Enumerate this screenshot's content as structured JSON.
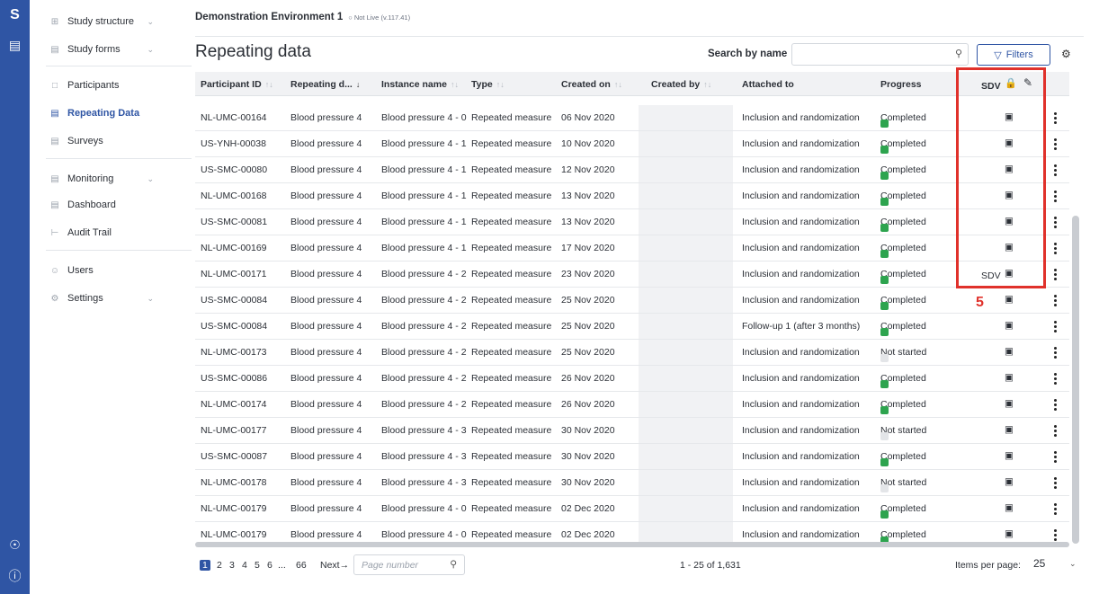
{
  "rail": {
    "logo": "S",
    "book_icon": "book-icon",
    "bottom_icons": [
      "user-circle-icon",
      "help-circle-icon"
    ]
  },
  "sidebar": {
    "items": [
      {
        "label": "Study structure",
        "icon": "structure-icon",
        "chevron": true
      },
      {
        "label": "Study forms",
        "icon": "forms-icon",
        "chevron": true
      },
      {
        "label": "Participants",
        "icon": "folder-icon"
      },
      {
        "label": "Repeating Data",
        "icon": "repeating-data-icon",
        "active": true
      },
      {
        "label": "Surveys",
        "icon": "surveys-icon"
      },
      {
        "label": "Monitoring",
        "icon": "monitoring-icon",
        "chevron": true
      },
      {
        "label": "Dashboard",
        "icon": "dashboard-icon"
      },
      {
        "label": "Audit Trail",
        "icon": "audit-trail-icon"
      },
      {
        "label": "Users",
        "icon": "users-icon"
      },
      {
        "label": "Settings",
        "icon": "settings-icon",
        "chevron": true
      }
    ]
  },
  "header": {
    "env_name": "Demonstration Environment 1",
    "env_status": "Not Live (v.117.41)"
  },
  "page": {
    "title": "Repeating data",
    "search_label": "Search by name",
    "search_placeholder": "",
    "filters_label": "Filters"
  },
  "table": {
    "columns": [
      "Participant ID",
      "Repeating d...",
      "Instance name",
      "Type",
      "Created on",
      "Created by",
      "Attached to",
      "Progress"
    ],
    "rows": [
      {
        "pid": "NL-UMC-00164",
        "rd": "Blood pressure 4",
        "inst": "Blood pressure 4 - 0",
        "type": "Repeated measure",
        "created": "06 Nov 2020",
        "attached": "Inclusion and randomization",
        "progress": "Completed",
        "sdv": false
      },
      {
        "pid": "US-YNH-00038",
        "rd": "Blood pressure 4",
        "inst": "Blood pressure 4 - 1",
        "type": "Repeated measure",
        "created": "10 Nov 2020",
        "attached": "Inclusion and randomization",
        "progress": "Completed",
        "sdv": false
      },
      {
        "pid": "US-SMC-00080",
        "rd": "Blood pressure 4",
        "inst": "Blood pressure 4 - 1",
        "type": "Repeated measure",
        "created": "12 Nov 2020",
        "attached": "Inclusion and randomization",
        "progress": "Completed",
        "sdv": false
      },
      {
        "pid": "NL-UMC-00168",
        "rd": "Blood pressure 4",
        "inst": "Blood pressure 4 - 1",
        "type": "Repeated measure",
        "created": "13 Nov 2020",
        "attached": "Inclusion and randomization",
        "progress": "Completed",
        "sdv": false
      },
      {
        "pid": "US-SMC-00081",
        "rd": "Blood pressure 4",
        "inst": "Blood pressure 4 - 1",
        "type": "Repeated measure",
        "created": "13 Nov 2020",
        "attached": "Inclusion and randomization",
        "progress": "Completed",
        "sdv": false
      },
      {
        "pid": "NL-UMC-00169",
        "rd": "Blood pressure 4",
        "inst": "Blood pressure 4 - 1",
        "type": "Repeated measure",
        "created": "17 Nov 2020",
        "attached": "Inclusion and randomization",
        "progress": "Completed",
        "sdv": false
      },
      {
        "pid": "NL-UMC-00171",
        "rd": "Blood pressure 4",
        "inst": "Blood pressure 4 - 2",
        "type": "Repeated measure",
        "created": "23 Nov 2020",
        "attached": "Inclusion and randomization",
        "progress": "Completed",
        "sdv": true
      },
      {
        "pid": "US-SMC-00084",
        "rd": "Blood pressure 4",
        "inst": "Blood pressure 4 - 2",
        "type": "Repeated measure",
        "created": "25 Nov 2020",
        "attached": "Inclusion and randomization",
        "progress": "Completed",
        "sdv": false
      },
      {
        "pid": "US-SMC-00084",
        "rd": "Blood pressure 4",
        "inst": "Blood pressure 4 - 2",
        "type": "Repeated measure",
        "created": "25 Nov 2020",
        "attached": "Follow-up 1 (after 3 months)",
        "progress": "Completed",
        "sdv": false
      },
      {
        "pid": "NL-UMC-00173",
        "rd": "Blood pressure 4",
        "inst": "Blood pressure 4 - 2",
        "type": "Repeated measure",
        "created": "25 Nov 2020",
        "attached": "Inclusion and randomization",
        "progress": "Not started",
        "sdv": false
      },
      {
        "pid": "US-SMC-00086",
        "rd": "Blood pressure 4",
        "inst": "Blood pressure 4 - 2",
        "type": "Repeated measure",
        "created": "26 Nov 2020",
        "attached": "Inclusion and randomization",
        "progress": "Completed",
        "sdv": false
      },
      {
        "pid": "NL-UMC-00174",
        "rd": "Blood pressure 4",
        "inst": "Blood pressure 4 - 2",
        "type": "Repeated measure",
        "created": "26 Nov 2020",
        "attached": "Inclusion and randomization",
        "progress": "Completed",
        "sdv": false
      },
      {
        "pid": "NL-UMC-00177",
        "rd": "Blood pressure 4",
        "inst": "Blood pressure 4 - 3",
        "type": "Repeated measure",
        "created": "30 Nov 2020",
        "attached": "Inclusion and randomization",
        "progress": "Not started",
        "sdv": false
      },
      {
        "pid": "US-SMC-00087",
        "rd": "Blood pressure 4",
        "inst": "Blood pressure 4 - 3",
        "type": "Repeated measure",
        "created": "30 Nov 2020",
        "attached": "Inclusion and randomization",
        "progress": "Completed",
        "sdv": false
      },
      {
        "pid": "NL-UMC-00178",
        "rd": "Blood pressure 4",
        "inst": "Blood pressure 4 - 3",
        "type": "Repeated measure",
        "created": "30 Nov 2020",
        "attached": "Inclusion and randomization",
        "progress": "Not started",
        "sdv": false
      },
      {
        "pid": "NL-UMC-00179",
        "rd": "Blood pressure 4",
        "inst": "Blood pressure 4 - 0",
        "type": "Repeated measure",
        "created": "02 Dec 2020",
        "attached": "Inclusion and randomization",
        "progress": "Completed",
        "sdv": false
      },
      {
        "pid": "NL-UMC-00179",
        "rd": "Blood pressure 4",
        "inst": "Blood pressure 4 - 0",
        "type": "Repeated measure",
        "created": "02 Dec 2020",
        "attached": "Inclusion and randomization",
        "progress": "Completed",
        "sdv": false
      }
    ]
  },
  "pagination": {
    "pages": [
      "1",
      "2",
      "3",
      "4",
      "5",
      "6",
      "...",
      "66"
    ],
    "next_label": "Next",
    "page_number_placeholder": "Page number",
    "range_text": "1 - 25 of 1,631",
    "items_per_page_label": "Items per page:",
    "items_per_page_value": "25"
  },
  "annotation": {
    "label": "5",
    "color": "#e0312b"
  },
  "colors": {
    "brand": "#2f55a4",
    "completed": "#2ea44f",
    "not_started": "#e3e5e8",
    "lock": "#3a6bd1"
  }
}
